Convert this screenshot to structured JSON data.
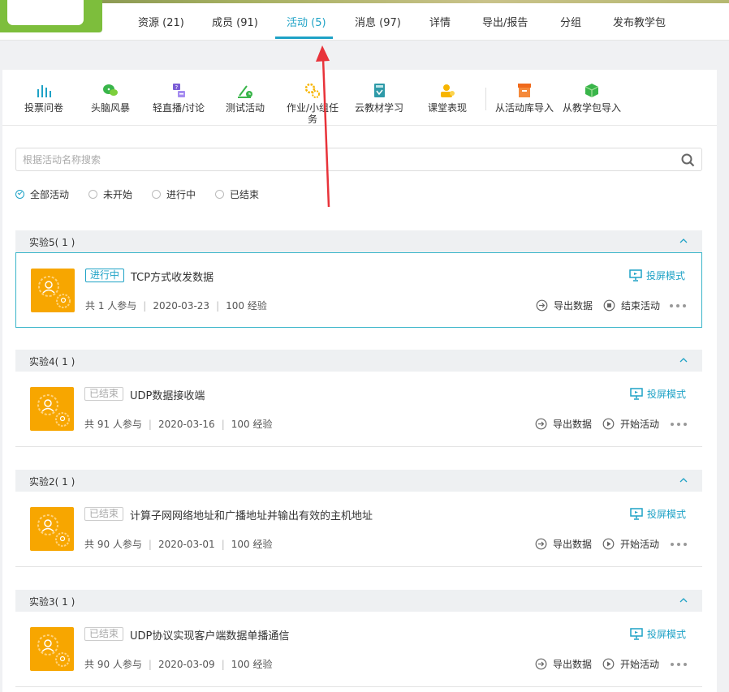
{
  "header": {
    "tabs": [
      {
        "label": "资源 (21)",
        "active": false
      },
      {
        "label": "成员 (91)",
        "active": false
      },
      {
        "label": "活动 (5)",
        "active": true
      },
      {
        "label": "消息 (97)",
        "active": false
      },
      {
        "label": "详情",
        "active": false
      },
      {
        "label": "导出/报告",
        "active": false
      },
      {
        "label": "分组",
        "active": false
      },
      {
        "label": "发布教学包",
        "active": false
      }
    ]
  },
  "toolbar": {
    "tools": [
      {
        "label": "投票问卷",
        "icon": "bar-chart-icon"
      },
      {
        "label": "头脑风暴",
        "icon": "chat-bubbles-icon"
      },
      {
        "label": "轻直播/讨论",
        "icon": "discussion-icon"
      },
      {
        "label": "测试活动",
        "icon": "test-icon"
      },
      {
        "label": "作业/小组任务",
        "icon": "gear-task-icon"
      },
      {
        "label": "云教材学习",
        "icon": "book-icon"
      },
      {
        "label": "课堂表现",
        "icon": "performance-icon"
      },
      {
        "label": "从活动库导入",
        "icon": "archive-icon"
      },
      {
        "label": "从教学包导入",
        "icon": "package-icon"
      }
    ]
  },
  "search": {
    "placeholder": "根据活动名称搜索"
  },
  "filters": [
    {
      "label": "全部活动",
      "selected": true
    },
    {
      "label": "未开始",
      "selected": false
    },
    {
      "label": "进行中",
      "selected": false
    },
    {
      "label": "已结束",
      "selected": false
    }
  ],
  "groups": [
    {
      "title": "实验5( 1 )",
      "activity": {
        "status": "进行中",
        "title": "TCP方式收发数据",
        "participants": "共 1 人参与",
        "date": "2020-03-23",
        "exp": "100 经验",
        "projection": "投屏模式",
        "export": "导出数据",
        "action": "结束活动"
      }
    },
    {
      "title": "实验4( 1 )",
      "activity": {
        "status": "已结束",
        "title": "UDP数据接收端",
        "participants": "共 91 人参与",
        "date": "2020-03-16",
        "exp": "100 经验",
        "projection": "投屏模式",
        "export": "导出数据",
        "action": "开始活动"
      }
    },
    {
      "title": "实验2( 1 )",
      "activity": {
        "status": "已结束",
        "title": "计算子网网络地址和广播地址并输出有效的主机地址",
        "participants": "共 90 人参与",
        "date": "2020-03-01",
        "exp": "100 经验",
        "projection": "投屏模式",
        "export": "导出数据",
        "action": "开始活动"
      }
    },
    {
      "title": "实验3( 1 )",
      "activity": {
        "status": "已结束",
        "title": "UDP协议实现客户端数据单播通信",
        "participants": "共 90 人参与",
        "date": "2020-03-09",
        "exp": "100 经验",
        "projection": "投屏模式",
        "export": "导出数据",
        "action": "开始活动"
      }
    }
  ],
  "colors": {
    "accent": "#1ea2c6",
    "thumb": "#f7a600",
    "annotation": "#e8333a"
  }
}
